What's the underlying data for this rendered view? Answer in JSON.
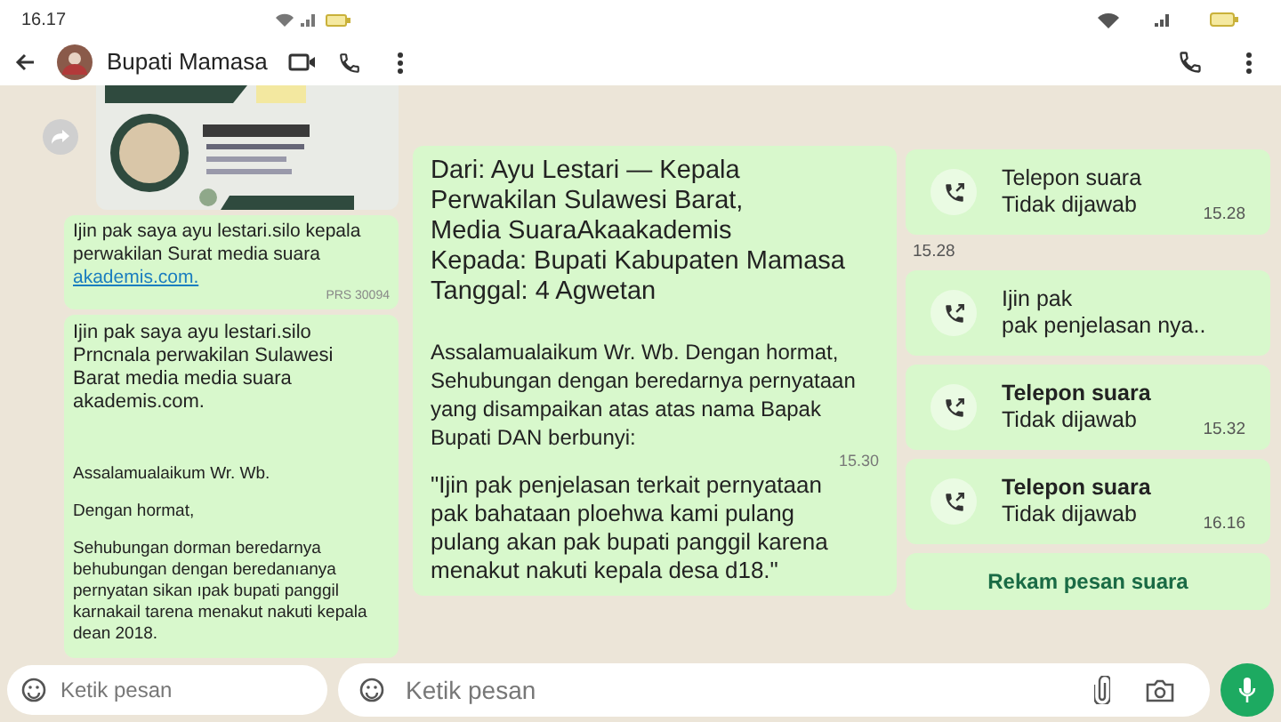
{
  "status_bar": {
    "time": "16.17"
  },
  "header": {
    "title": "Bupati Mamasa"
  },
  "left_messages": [
    {
      "text": "Ijin pak saya ayu lestari.silo kepala perwakilan Surat media suara",
      "link": "akademis.com.",
      "meta": "PRS 30094"
    },
    {
      "kind": "text",
      "paragraphs": [
        "Ijin pak saya ayu lestari.silo Prncnala perwakilan Sulawesi Barat media media suara akademis.com.",
        "Assalamualaikum Wr. Wb.",
        "Dengan hormat,",
        "Sehubungan dorman beredarnya behubungan dengan beredanıanya pernyatan sikan ıpak bupati panggil karnakail tarena menakut nakuti kepala dean 2018."
      ]
    }
  ],
  "letter": {
    "heading_lines": [
      "Dari: Ayu Lestari — Kepala",
      "Perwakilan Sulawesi Barat,",
      "Media SuaraAkaakademis",
      "Kepada: Bupati Kabupaten Mamasa",
      "Tanggal: 4 Agwetan"
    ],
    "body": "Assalamualaikum Wr. Wb. Dengan hormat, Sehubungan dengan beredarnya pernyataan yang disampaikan atas atas nama Bapak Bupati DAN berbunyi:",
    "time": "15.30",
    "quote": "\"Ijin pak penjelasan terkait pernyataan pak bahataan ploehwa kami pulang pulang akan pak bupati panggil karena menakut nakuti kepala desa d18.\""
  },
  "right_messages": [
    {
      "kind": "call",
      "title": "Telepon suara",
      "subtitle": "Tidak dijawab",
      "time": "15.28",
      "bold": false
    },
    {
      "kind": "timestamp",
      "time": "15.28"
    },
    {
      "kind": "call",
      "title": "Ijin pak",
      "subtitle": "pak penjelasan nya..",
      "bold": false
    },
    {
      "kind": "call",
      "title": "Telepon suara",
      "subtitle": "Tidak dijawab",
      "time": "15.32",
      "bold": true
    },
    {
      "kind": "call",
      "title": "Telepon suara",
      "subtitle": "Tidak dijawab",
      "time": "16.16",
      "bold": true
    },
    {
      "kind": "action",
      "label": "Rekam pesan suara"
    }
  ],
  "input_fields": [
    {
      "placeholder": "Ketik pesan"
    },
    {
      "placeholder": "Ketik pesan"
    }
  ]
}
